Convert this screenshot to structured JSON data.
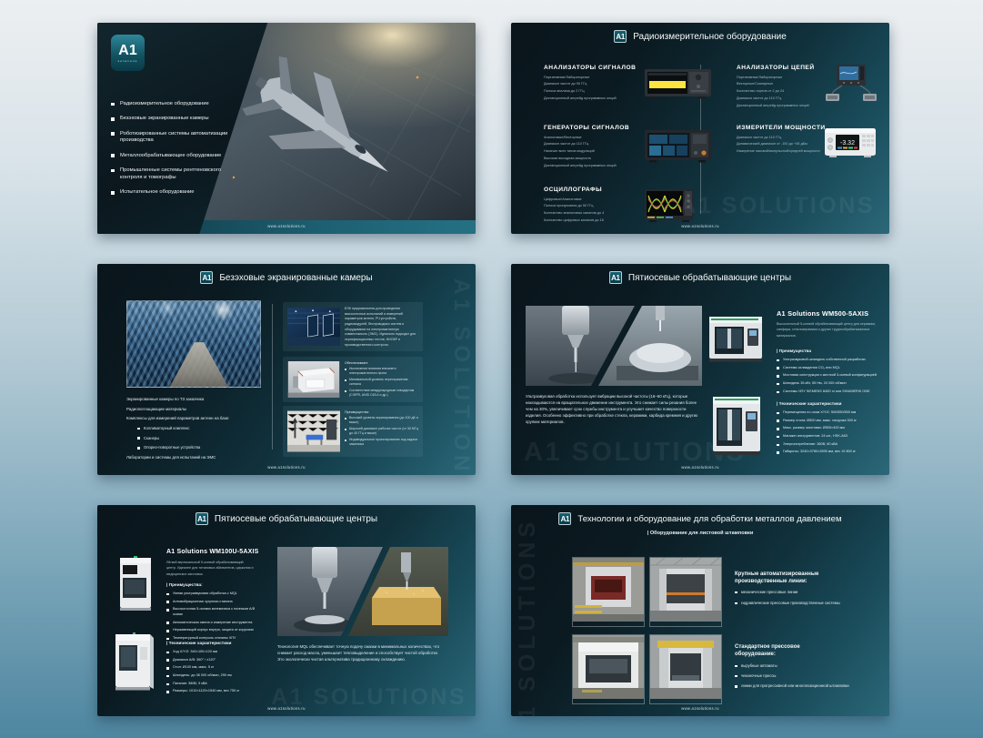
{
  "url": "www.a1solutions.ru",
  "brand": {
    "logo": "A1",
    "logo_sub": "solutions",
    "watermark": "A1 SOLUTIONS"
  },
  "colors": {
    "slide_dark": "#0a151b",
    "slide_teal": "#2b6879",
    "logo_teal": "#115260",
    "page_top": "#eceff1",
    "page_bottom": "#4e86a0"
  },
  "s1": {
    "items": [
      "Радиоизмерительное оборудование",
      "Безэховые экранированные камеры",
      "Роботизированные системы автоматизации производства",
      "Металлообрабатывающее оборудование",
      "Промышленные системы рентгеновского контроля и томографы",
      "Испытательное оборудование"
    ]
  },
  "s2": {
    "title": "Радиоизмерительное оборудование",
    "signal_analyzers": {
      "heading": "АНАЛИЗАТОРЫ СИГНАЛОВ",
      "lines": [
        "Портативные/Лабораторные",
        "Диапазон частот до 90 ГГц",
        "Полоса анализа до 2 ГГц",
        "Дистанционный апгрейд программных опций"
      ]
    },
    "signal_generators": {
      "heading": "ГЕНЕРАТОРЫ СИГНАЛОВ",
      "lines": [
        "Аналоговые/Векторные",
        "Диапазон частот до 110 ГГц",
        "Наличие всех типов модуляций",
        "Высокая выходная мощность",
        "Дистанционный апгрейд программных опций"
      ]
    },
    "oscilloscopes": {
      "heading": "ОСЦИЛЛОГРАФЫ",
      "lines": [
        "Цифровые/Аналоговые",
        "Полоса пропускания до 50 ГГц",
        "Количество аналоговых каналов до 4",
        "Количество цифровых каналов до 16"
      ]
    },
    "network_analyzers": {
      "heading": "АНАЛИЗАТОРЫ ЦЕПЕЙ",
      "lines": [
        "Портативные/Лабораторные",
        "Векторные/Скалярные",
        "Количество портов от 2 до 24",
        "Диапазон частот до 110 ГГц",
        "Дистанционный апгрейд программных опций"
      ]
    },
    "power_meters": {
      "heading": "ИЗМЕРИТЕЛИ МОЩНОСТИ",
      "lines": [
        "Диапазон частот до 110 ГГц",
        "Динамический диапазон от -100 до +45 дБм",
        "Измерение пиковой/импульсной/средней мощности"
      ],
      "display_value": "-3.32"
    }
  },
  "s3": {
    "title": "Безэховые экранированные камеры",
    "intro_lines": [
      "Экранированные камеры по ТЗ заказчика",
      "Радиопоглощающие материалы",
      "Комплексы для измерений параметров антенн на базе:"
    ],
    "base_items": [
      "Коллиматорный комплекс",
      "Сканеры",
      "Опорно-поворотные устройства"
    ],
    "outro": "Лаборатории и системы для испытаний на ЭМС",
    "card1_text": "БЭК предназначены для проведения высокоточных испытаний и измерений параметров антенн, РЧ устройств, радиомодулей, беспроводных систем и оборудования на электромагнитную совместимость (ЭМС). Идеально подходят для сертификационных тестов, НИОКР и производственного контроля.",
    "card2": {
      "heading": "Обеспечивают:",
      "items": [
        "Исключение влияния внешнего электромагнитного фона",
        "Минимальный уровень переотражения сигнала",
        "Соответствие международным стандартам (CISPR, ANSI C63.4 и др.)"
      ]
    },
    "card3": {
      "heading": "Преимущества:",
      "items": [
        "Высокий уровень экранирования (до 100 дБ и выше)",
        "Широкий диапазон рабочих частот (от 30 МГц до 40 ГГц и выше)",
        "Индивидуальное проектирование под задачи заказчика"
      ]
    }
  },
  "s4": {
    "title": "Пятиосевые обрабатывающие центры",
    "paragraph": "Ультразвуковая обработка использует вибрации высокой частоты (16–60 кГц), которые накладываются на вращательное движение инструмента. Это снижает силы резания более чем на 30%, увеличивает срок службы инструмента и улучшает качество поверхности изделия. Особенно эффективно при обработке стекла, керамики, карбида кремния и других хрупких материалов.",
    "product": "A1 Solutions WM500-5AXIS",
    "description": "Высокоточный 5-осевой обрабатывающий центр для керамики, сапфира, стеклокерамики и других труднообрабатываемых материалов.",
    "advantages": {
      "heading": "| Преимущества",
      "items": [
        "Ультразвуковой шпиндель собственной разработки",
        "Система охлаждения CO₂ или MQL",
        "Мостовая конструкция с жесткой 3-осевой конфигурацией",
        "Шпиндель 35 кВт, 55 Нм, 20 000 об/мин",
        "Системы ЧПУ SIEMENS 840D sl или SINUMERIK ONE"
      ]
    },
    "specs": {
      "heading": "| Технические характеристики",
      "items": [
        "Перемещения по осям X/Y/Z: 500/550/500 мм",
        "Размер стола: Ø500 мм, макс. нагрузка 300 кг",
        "Макс. размер заготовки: Ø500×400 мм",
        "Магазин инструментов: 24 шт., HSK-A63",
        "Энергопотребление: 380В, 60 кВА",
        "Габариты: 3240×3780×2895 мм, вес 10 800 кг"
      ]
    }
  },
  "s5": {
    "title": "Пятиосевые обрабатывающие центры",
    "product": "A1 Solutions WM100U-5AXIS",
    "description": "Лёгкий вертикальный 5-осевой обрабатывающий центр. Идеален для титановых абатментов, циркония и медицинских заготовок.",
    "advantages": {
      "heading": "| Преимущества:",
      "items": [
        "Умная ультразвуковая обработка с MQL",
        "Антивибрационная чугунная станина",
        "Высокоточная 5-осевая кинематика с полными A/B осями",
        "Автоматическая смена и измерение инструмента",
        "Нержавеющий корпус внутри, защита от коррозии",
        "Температурный контроль станины ЧПУ"
      ]
    },
    "specs": {
      "heading": "| Технические характеристики",
      "items": [
        "Ход X/Y/Z: 340×100×120 мм",
        "Диапазон A/B: 360° / ±120°",
        "Стол: Ø100 мм, макс. 5 кг",
        "Шпиндель: до 36 000 об/мин, 290 нм",
        "Питание: 380В, 9 кВА",
        "Размеры: 1010×1120×1540 мм, вес 750 кг"
      ]
    },
    "paragraph": "Технология MQL обеспечивает точную подачу смазки в минимальных количествах, что снижает расход масла, уменьшает тепловыделение и способствует чистой обработке. Это экологически чистая альтернатива традиционному охлаждению."
  },
  "s6": {
    "title": "Технологии и оборудование для обработки металлов давлением",
    "subtitle": "| Оборудование для листовой штамповки",
    "block1": {
      "heading": "Крупные автоматизированные производственные линии:",
      "items": [
        "механические прессовые линии",
        "гидравлические прессовые производственные системы"
      ]
    },
    "block2": {
      "heading": "Стандартное прессовое оборудование:",
      "items": [
        "вырубные автоматы",
        "чеканочные прессы",
        "линии для прогрессивной или многопозиционной штамповки"
      ]
    }
  }
}
